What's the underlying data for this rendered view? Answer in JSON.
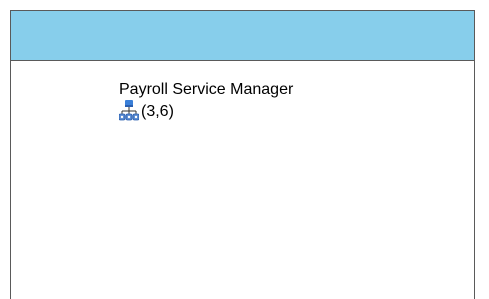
{
  "header": {
    "color": "#87ceeb"
  },
  "node": {
    "title": "Payroll Service Manager",
    "icon": "org-chart-icon",
    "coordinates": "(3,6)"
  },
  "colors": {
    "header_bg": "#87ceeb",
    "icon_top": "#3a7fd8",
    "icon_children": "#5a8ad0"
  }
}
